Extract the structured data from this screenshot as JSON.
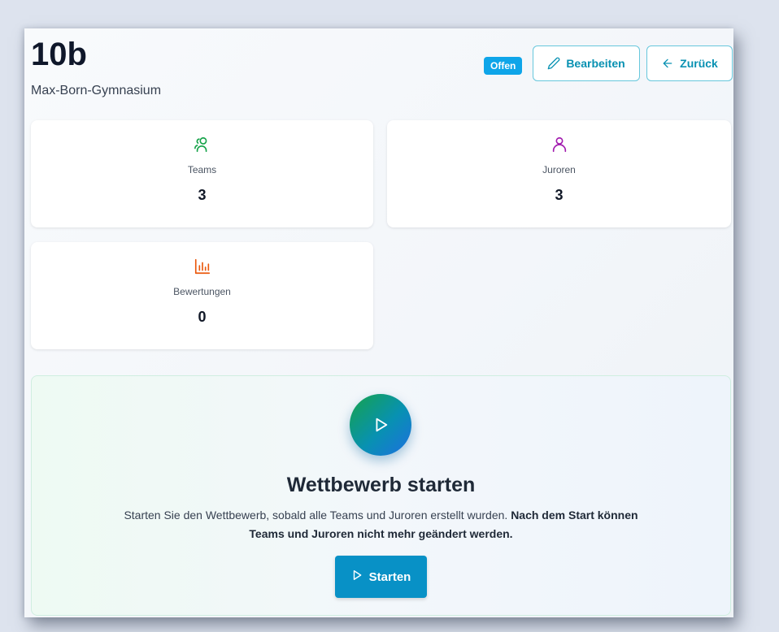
{
  "header": {
    "title": "10b",
    "subtitle": "Max-Born-Gymnasium",
    "status_badge": "Offen",
    "edit_label": "Bearbeiten",
    "back_label": "Zurück"
  },
  "stats": [
    {
      "label": "Teams",
      "value": "3",
      "icon": "users-icon",
      "color": "#16a34a"
    },
    {
      "label": "Juroren",
      "value": "3",
      "icon": "user-icon",
      "color": "#a21caf"
    },
    {
      "label": "Bewertungen",
      "value": "0",
      "icon": "bar-chart-icon",
      "color": "#ea580c"
    }
  ],
  "start_panel": {
    "title": "Wettbewerb starten",
    "description": "Starten Sie den Wettbewerb, sobald alle Teams und Juroren erstellt wurden.",
    "description_bold": "Nach dem Start können Teams und Juroren nicht mehr geändert werden.",
    "button_label": "Starten"
  },
  "colors": {
    "accent": "#0891b2",
    "badge": "#0ea5e9",
    "button": "#0891c6"
  }
}
